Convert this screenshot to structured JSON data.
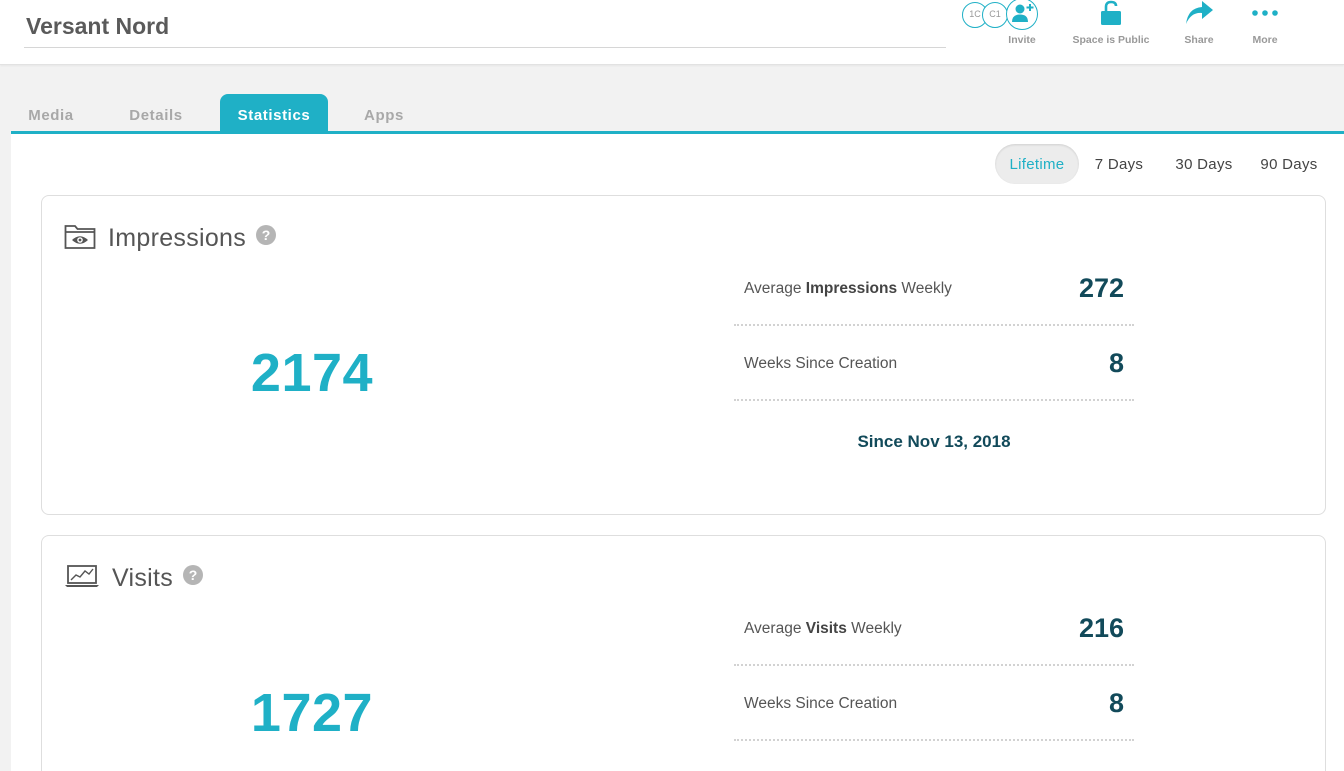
{
  "header": {
    "title": "Versant Nord",
    "avatars": [
      "1C",
      "C1"
    ],
    "actions": {
      "invite": "Invite",
      "public": "Space is Public",
      "share": "Share",
      "more": "More"
    }
  },
  "tabs": [
    {
      "label": "Media"
    },
    {
      "label": "Details"
    },
    {
      "label": "Statistics",
      "active": true
    },
    {
      "label": "Apps"
    }
  ],
  "ranges": {
    "selected": "Lifetime",
    "options": [
      "Lifetime",
      "7 Days",
      "30 Days",
      "90 Days"
    ]
  },
  "impressions": {
    "title": "Impressions",
    "total": "2174",
    "avg_prefix": "Average ",
    "avg_bold": "Impressions",
    "avg_suffix": " Weekly",
    "avg_value": "272",
    "weeks_label": "Weeks Since Creation",
    "weeks_value": "8",
    "since": "Since Nov 13, 2018"
  },
  "visits": {
    "title": "Visits",
    "total": "1727",
    "avg_prefix": "Average ",
    "avg_bold": "Visits",
    "avg_suffix": " Weekly",
    "avg_value": "216",
    "weeks_label": "Weeks Since Creation",
    "weeks_value": "8"
  },
  "colors": {
    "accent": "#1fb0c6",
    "value_dark": "#124a5a"
  },
  "icons": {
    "impressions": "folder-eye-icon",
    "visits": "laptop-chart-icon",
    "help": "question-circle-icon",
    "invite": "user-add-icon",
    "public": "unlock-icon",
    "share": "share-arrow-icon",
    "more": "more-dots-icon"
  }
}
